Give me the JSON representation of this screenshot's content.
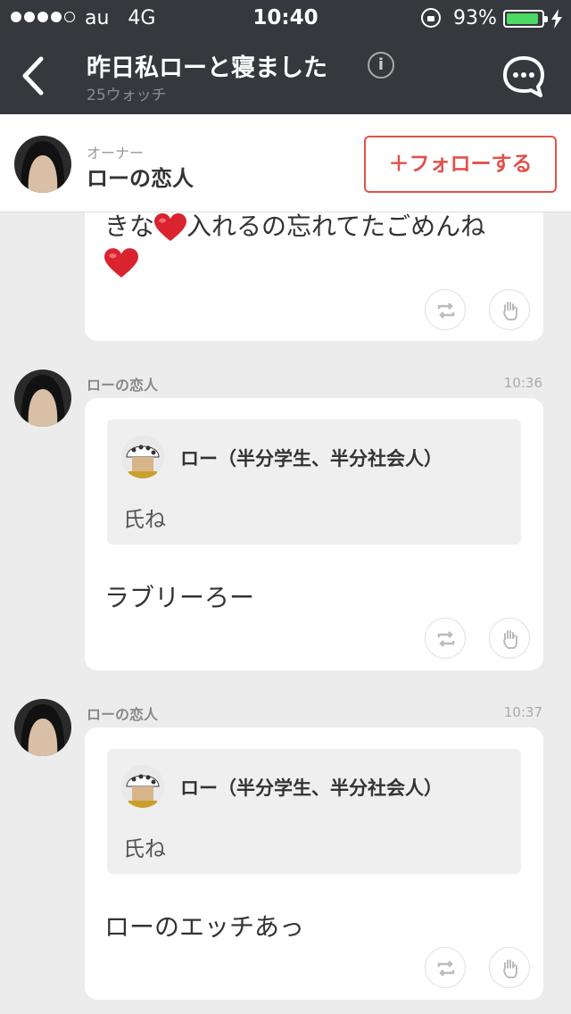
{
  "status": {
    "carrier": "au",
    "network": "4G",
    "time": "10:40",
    "battery": "93%"
  },
  "nav": {
    "title": "昨日私ローと寝ました",
    "watch_count": "25ウォッチ"
  },
  "owner": {
    "role": "オーナー",
    "name": "ローの恋人",
    "follow_label": "＋フォローする"
  },
  "messages": [
    {
      "lines": [
        "きな",
        "入れるの忘れてたごめんね"
      ]
    },
    {
      "sender": "ローの恋人",
      "time": "10:36",
      "quote_name": "ロー（半分学生、半分社会人）",
      "quote_text": "氏ね",
      "text": "ラブリーろー"
    },
    {
      "sender": "ローの恋人",
      "time": "10:37",
      "quote_name": "ロー（半分学生、半分社会人）",
      "quote_text": "氏ね",
      "text": "ローのエッチあっ"
    }
  ],
  "colors": {
    "accent": "#e0524c",
    "nav_bg": "#35383c",
    "battery": "#4cd964"
  },
  "icons": [
    "back-icon",
    "info-icon",
    "chat-bubble-icon",
    "repost-icon",
    "clap-hand-icon",
    "heart-emoji-icon"
  ]
}
